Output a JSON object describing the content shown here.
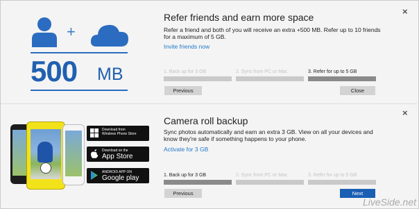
{
  "refer": {
    "title": "Refer friends and earn more space",
    "body": "Refer a friend and both of you will receive an extra +500 MB. Refer up to 10 friends for a maximum of 5 GB.",
    "link": "Invite friends now",
    "hero_plus": "+",
    "hero_value": "500",
    "hero_unit": "MB",
    "steps": [
      {
        "label": "1. Back up for 3 GB",
        "active": false
      },
      {
        "label": "2. Sync from PC or Mac",
        "active": false
      },
      {
        "label": "3. Refer for up to 5 GB",
        "active": true
      }
    ],
    "previous_label": "Previous",
    "close_label": "Close"
  },
  "camera": {
    "title": "Camera roll backup",
    "body": "Sync photos automatically and earn an extra 3 GB. View on all your devices and know they're safe if something happens to your phone.",
    "link": "Activate for 3 GB",
    "steps": [
      {
        "label": "1. Back up for 3 GB",
        "active": true
      },
      {
        "label": "2. Sync from PC or Mac",
        "active": false
      },
      {
        "label": "3. Refer for up to 5 GB",
        "active": false
      }
    ],
    "previous_label": "Previous",
    "next_label": "Next",
    "badges": {
      "windows": {
        "line1": "Download from",
        "line2": "Windows Phone Store"
      },
      "apple": {
        "small": "Download on the",
        "big": "App Store"
      },
      "google": {
        "small": "ANDROID APP ON",
        "big": "Google play"
      }
    }
  },
  "close_glyph": "×",
  "watermark": "LiveSide.net",
  "colors": {
    "accent": "#1a5fb4",
    "link": "#1f78c8",
    "hero": "#2060b0"
  }
}
